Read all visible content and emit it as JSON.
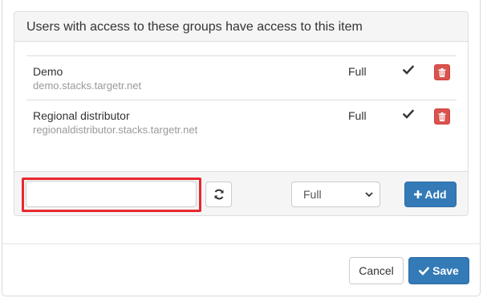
{
  "panel": {
    "heading": "Users with access to these groups have access to this item"
  },
  "groups": [
    {
      "name": "Demo",
      "host": "demo.stacks.targetr.net",
      "access": "Full",
      "check_icon": "check-icon",
      "delete_icon": "trash-icon"
    },
    {
      "name": "Regional distributor",
      "host": "regionaldistributor.stacks.targetr.net",
      "access": "Full",
      "check_icon": "check-icon",
      "delete_icon": "trash-icon"
    }
  ],
  "add_bar": {
    "input_value": "",
    "input_placeholder": "",
    "refresh_icon": "refresh-icon",
    "select_value": "Full",
    "select_icon": "chevron-down-icon",
    "add_label": "Add",
    "add_icon": "plus-icon"
  },
  "footer": {
    "cancel_label": "Cancel",
    "save_label": "Save",
    "save_icon": "check-icon"
  },
  "colors": {
    "primary": "#337ab7",
    "danger": "#d9534f",
    "highlight": "#e8282f",
    "muted_text": "#999999"
  }
}
